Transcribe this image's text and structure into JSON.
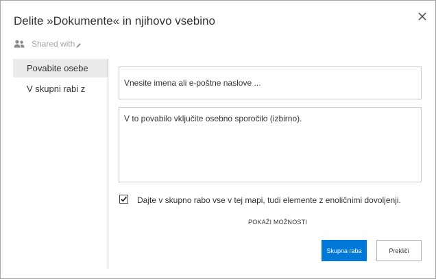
{
  "dialog": {
    "title": "Delite »Dokumente« in njihovo vsebino",
    "close_icon": "close-icon",
    "shared_with": {
      "label": "Shared with",
      "people_icon": "people-icon",
      "edit_icon": "pencil-icon"
    }
  },
  "nav": {
    "items": [
      {
        "label": "Povabite osebe",
        "selected": true
      },
      {
        "label": "V skupni rabi z",
        "selected": false
      }
    ]
  },
  "form": {
    "names_placeholder": "Vnesite imena ali e-poštne naslove ...",
    "names_value": "",
    "message_placeholder": "V to povabilo vključite osebno sporočilo (izbirno).",
    "message_value": "",
    "share_all_checked": true,
    "share_all_label": "Dajte v skupno rabo vse v tej mapi, tudi elemente z enoličnimi dovoljenji.",
    "show_options_label": "POKAŽI MOŽNOSTI"
  },
  "buttons": {
    "share_label": "Skupna raba",
    "cancel_label": "Prekliči"
  },
  "colors": {
    "accent": "#0078d7",
    "selected_nav_background": "#eaeaea",
    "border": "#c8c8c8"
  }
}
